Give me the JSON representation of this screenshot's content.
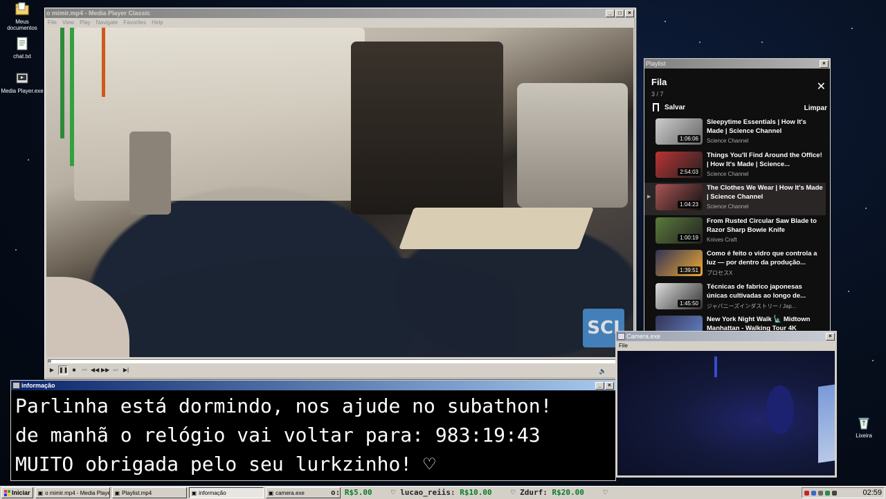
{
  "desktop": {
    "icons": [
      {
        "label": "Meus documentos",
        "icon": "folder-icon"
      },
      {
        "label": "chat.txt",
        "icon": "text-file-icon"
      },
      {
        "label": "Media Player.exe",
        "icon": "media-player-icon"
      },
      {
        "label": "Lixeira",
        "icon": "recycle-bin-icon"
      }
    ]
  },
  "player": {
    "title": "o mimir.mp4 - Media Player Classic",
    "menu": [
      "File",
      "View",
      "Play",
      "Navigate",
      "Favorites",
      "Help"
    ],
    "progress": 0.005,
    "controls": [
      "play",
      "pause",
      "stop",
      "previous",
      "frame-back",
      "frame-forward",
      "next",
      "frame-step"
    ],
    "watermark": "SCI"
  },
  "playlist": {
    "window_title": "Playlist",
    "heading": "Fila",
    "count": "3 / 7",
    "save_label": "Salvar",
    "clear_label": "Limpar",
    "items": [
      {
        "title": "Sleepytime Essentials | How It's Made | Science Channel",
        "channel": "Science Channel",
        "duration": "1:06:06",
        "current": false
      },
      {
        "title": "Things You'll Find Around the Office! | How It's Made | Science...",
        "channel": "Science Channel",
        "duration": "2:54:03",
        "current": false
      },
      {
        "title": "The Clothes We Wear | How It's Made | Science Channel",
        "channel": "Science Channel",
        "duration": "1:04:23",
        "current": true
      },
      {
        "title": "From Rusted Circular Saw Blade to Razor Sharp Bowie Knife",
        "channel": "Knives Craft",
        "duration": "1:00:19",
        "current": false
      },
      {
        "title": "Como é feito o vidro que controla a luz — por dentro da produção...",
        "channel": "プロセスX",
        "duration": "1:39:51",
        "current": false
      },
      {
        "title": "Técnicas de fabrico japonesas únicas cultivadas ao longo de...",
        "channel": "ジャパニーズインダストリー / Jap...",
        "duration": "1:45:50",
        "current": false
      },
      {
        "title": "New York Night Walk 🗽 Midtown Manhattan - Walking Tour 4K",
        "channel": "",
        "duration": "",
        "current": false
      }
    ]
  },
  "info": {
    "title": "informação",
    "lines": [
      "Parlinha está dormindo, nos ajude no subathon!",
      "de manhã o relógio vai voltar para:  983:19:43",
      "MUITO obrigada pelo seu lurkzinho! ♡"
    ]
  },
  "camera": {
    "title": "Camera.exe",
    "menu": [
      "File"
    ]
  },
  "taskbar": {
    "start_label": "Iniciar",
    "tasks": [
      {
        "label": "o mimir.mp4 - Media Playe...",
        "active": false
      },
      {
        "label": "Playlist.mp4",
        "active": false
      },
      {
        "label": "informação",
        "active": true
      },
      {
        "label": "camera.exe",
        "active": false
      }
    ],
    "ticker": [
      {
        "name": "o:",
        "amount": "R$5.00"
      },
      {
        "name": "lucao_reiis:",
        "amount": "R$10.00"
      },
      {
        "name": "Zdurf:",
        "amount": "R$20.00"
      }
    ],
    "clock": "02:59",
    "colors": {
      "accent_title": "#0a246a",
      "donation_amount": "#0a7a2a"
    }
  }
}
